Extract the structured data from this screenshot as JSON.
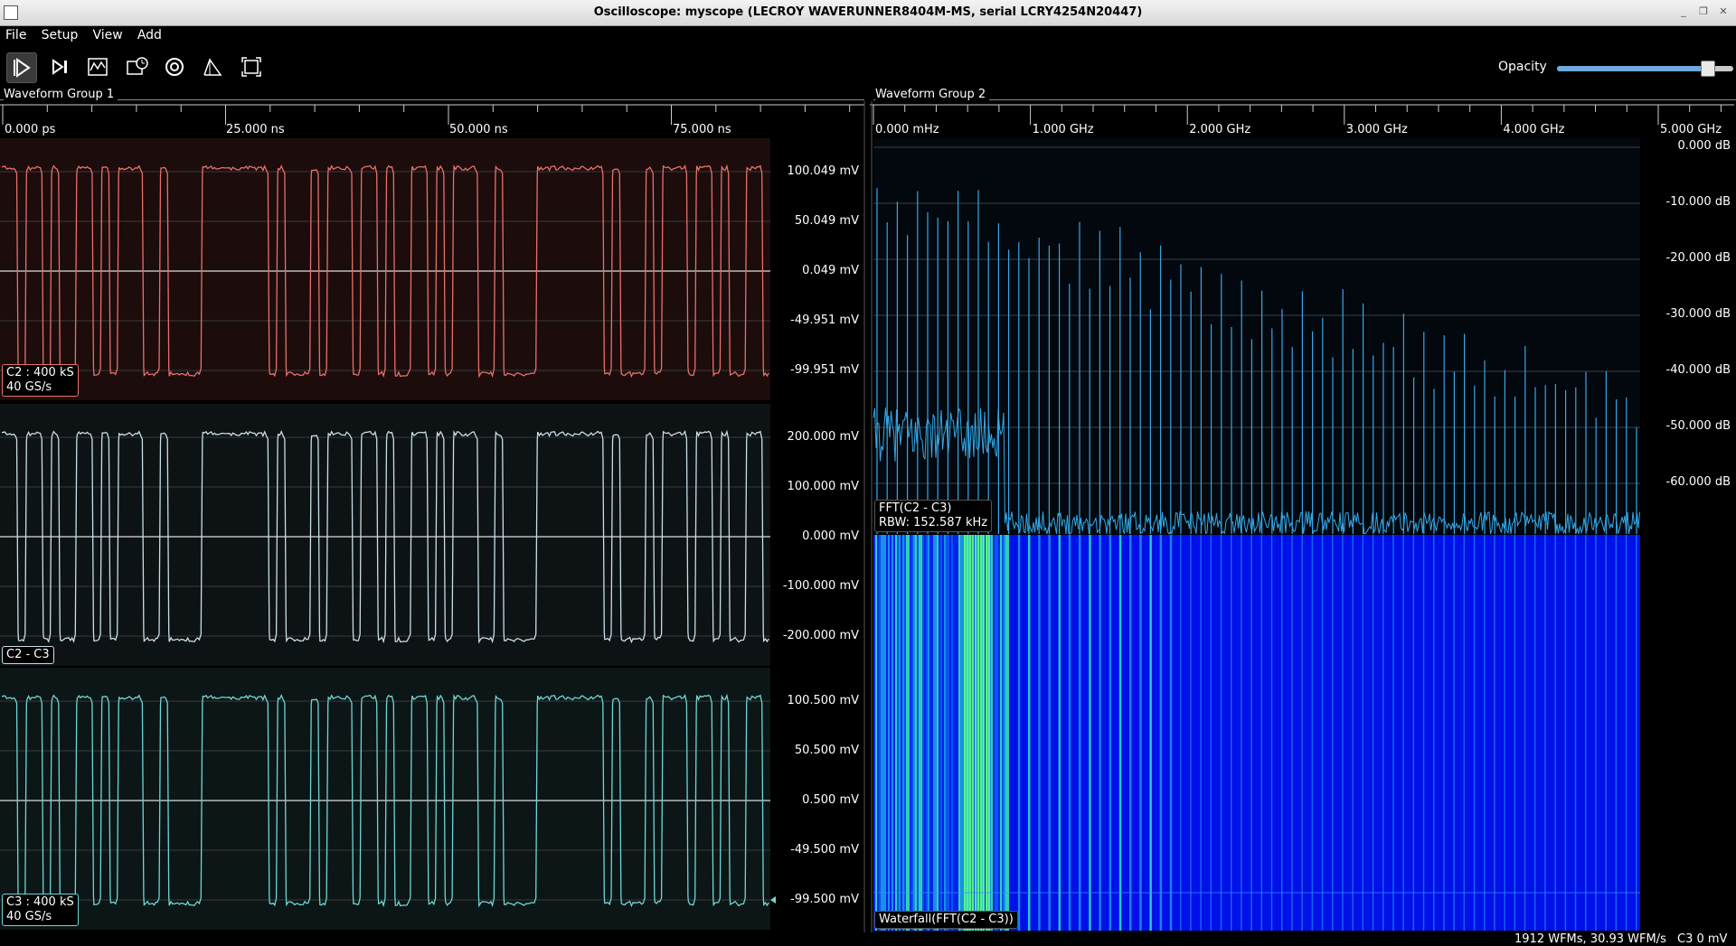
{
  "window": {
    "title": "Oscilloscope: myscope (LECROY WAVERUNNER8404M-MS, serial LCRY4254N20447)"
  },
  "menu": [
    "File",
    "Setup",
    "View",
    "Add"
  ],
  "toolbar": {
    "buttons": [
      {
        "name": "start-trigger-button-icon",
        "active": true
      },
      {
        "name": "single-trigger-button-icon",
        "active": false
      },
      {
        "name": "force-trigger-button-icon",
        "active": false
      },
      {
        "name": "history-button-icon",
        "active": false
      },
      {
        "name": "refresh-button-icon",
        "active": false
      },
      {
        "name": "measure-button-icon",
        "active": false
      },
      {
        "name": "fullscreen-button-icon",
        "active": false
      }
    ],
    "opacity_label": "Opacity",
    "opacity_value": 0.85
  },
  "group1": {
    "title": "Waveform Group 1",
    "ticks": [
      "0.000 ps",
      "25.000 ns",
      "50.000 ns",
      "75.000 ns"
    ],
    "channels": [
      {
        "label1": "C2 : 400 kS",
        "label2": "40 GS/s",
        "color": "#e8706a",
        "bg": "#1c0c0c",
        "ylabels": [
          "100.049 mV",
          "50.049 mV",
          "0.049 mV",
          "-49.951 mV",
          "-99.951 mV"
        ]
      },
      {
        "label1": "C2 - C3",
        "label2": "",
        "color": "#c8dfe8",
        "bg": "#0d1214",
        "ylabels": [
          "200.000 mV",
          "100.000 mV",
          "0.000 mV",
          "-100.000 mV",
          "-200.000 mV"
        ]
      },
      {
        "label1": "C3 : 400 kS",
        "label2": "40 GS/s",
        "color": "#6fd6d6",
        "bg": "#0c1616",
        "ylabels": [
          "100.500 mV",
          "50.500 mV",
          "0.500 mV",
          "-49.500 mV",
          "-99.500 mV"
        ]
      }
    ]
  },
  "group2": {
    "title": "Waveform Group 2",
    "ticks": [
      "0.000 mHz",
      "1.000 GHz",
      "2.000 GHz",
      "3.000 GHz",
      "4.000 GHz",
      "5.000 GHz"
    ],
    "ylabels": [
      "0.000 dB",
      "-10.000 dB",
      "-20.000 dB",
      "-30.000 dB",
      "-40.000 dB",
      "-50.000 dB",
      "-60.000 dB"
    ],
    "fft_label1": "FFT(C2 - C3)",
    "fft_label2": "RBW: 152.587 kHz",
    "waterfall_label": "Waterfall(FFT(C2 - C3))",
    "spectrum_color": "#35a7e6"
  },
  "status": {
    "wfms": "1912 WFMs, 30.93 WFM/s",
    "trigger": "C3 0 mV"
  }
}
